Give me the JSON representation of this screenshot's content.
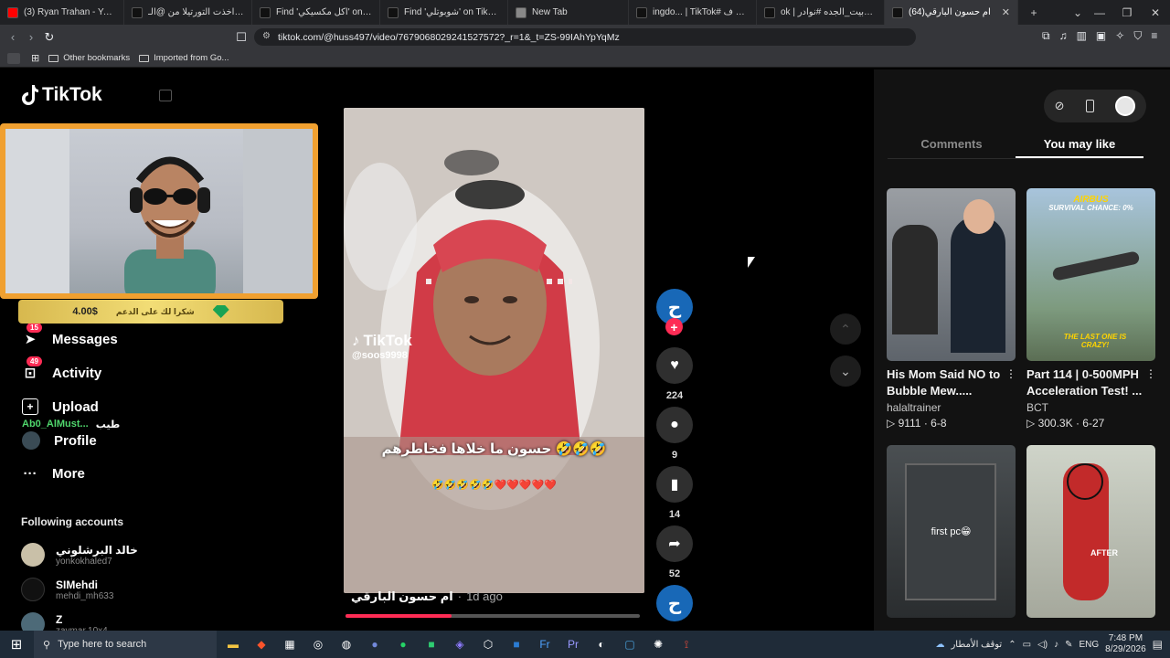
{
  "browser": {
    "tabs": [
      {
        "title": "(3) Ryan Trahan - YouTube",
        "fav_color": "#ff0000",
        "active": false
      },
      {
        "title": "انشيلادا اخذت التورتيلا من @الـ",
        "fav_color": "#111111",
        "active": false
      },
      {
        "title": "Find 'اكل مكسيكي' on TikTok |",
        "fav_color": "#111111",
        "active": false
      },
      {
        "title": "Find 'شوبوتلي' on TikTok | Tik",
        "fav_color": "#111111",
        "active": false
      },
      {
        "title": "New Tab",
        "fav_color": "#888888",
        "active": false
      },
      {
        "title": "ingdo... | TikTok# يمللني ف ||",
        "fav_color": "#111111",
        "active": false
      },
      {
        "title": "ok | منتدى_بيت_الجده #نوادر#",
        "fav_color": "#111111",
        "active": false
      },
      {
        "title": "(64)ام حسون البارقي",
        "fav_color": "#111111",
        "active": true
      }
    ],
    "url": "tiktok.com/@huss497/video/7679068029241527572?_r=1&_t=ZS-99IAhYpYqMz",
    "bookmarks": [
      "Other bookmarks",
      "Imported from Go..."
    ]
  },
  "sidebar": {
    "logo": "TikTok",
    "nav": [
      {
        "label": "Messages",
        "badge": "15",
        "icon": "send-icon"
      },
      {
        "label": "Activity",
        "badge": "49",
        "icon": "inbox-icon"
      },
      {
        "label": "Upload",
        "badge": "",
        "icon": "plus-square-icon"
      },
      {
        "label": "Profile",
        "badge": "",
        "icon": "avatar-icon"
      },
      {
        "label": "More",
        "badge": "",
        "icon": "ellipsis-icon"
      }
    ],
    "following_title": "Following accounts",
    "accounts": [
      {
        "name": "خالد البرشلوني",
        "handle": "yonkokhaled7"
      },
      {
        "name": "SIMehdi",
        "handle": "mehdi_mh633"
      },
      {
        "name": "Z",
        "handle": "zaymar.10x4"
      }
    ]
  },
  "overlay": {
    "donation_amount": "4.00$",
    "donation_text": "شكرا لك على الدعم",
    "chat_user": "Ab0_AlMust...",
    "chat_msg": "طيب"
  },
  "video": {
    "watermark_brand": "TikTok",
    "watermark_handle": "@soos9998",
    "caption_text": "حسون ما خلاها فخاطرهم 🤣🤣🤣",
    "emoji_row": "🤣🤣🤣🤣🤣❤️❤️❤️❤️❤️",
    "author": "ام حسون البارقي",
    "posted": "1d ago",
    "progress": 0.36,
    "avatar_letter": "ح"
  },
  "actions": {
    "likes": "224",
    "comments": "9",
    "saves": "14",
    "shares": "52"
  },
  "right_panel": {
    "tabs": [
      "Comments",
      "You may like"
    ],
    "active_tab": "You may like",
    "videos": [
      {
        "title": "His Mom Said NO to Bubble Mew.....",
        "author": "halaltrainer",
        "views": "9111",
        "date": "6-8"
      },
      {
        "title": "Part 114 | 0-500MPH Acceleration Test! ...",
        "author": "BCT",
        "views": "300.3K",
        "date": "6-27",
        "thumb_top": "AIRBUS",
        "thumb_top2": "SURVIVAL CHANCE: 0%",
        "thumb_mid": "THE LAST ONE IS CRAZY!"
      },
      {
        "title": "",
        "author": "",
        "views": "",
        "date": "",
        "thumb_mid": "first pc😁"
      },
      {
        "title": "",
        "author": "",
        "views": "",
        "date": "",
        "thumb_mid": "AFTER"
      }
    ]
  },
  "taskbar": {
    "search_placeholder": "Type here to search",
    "weather": "توقف الأمطار",
    "lang": "ENG",
    "time": "7:48 PM",
    "date": "8/29/2026"
  }
}
